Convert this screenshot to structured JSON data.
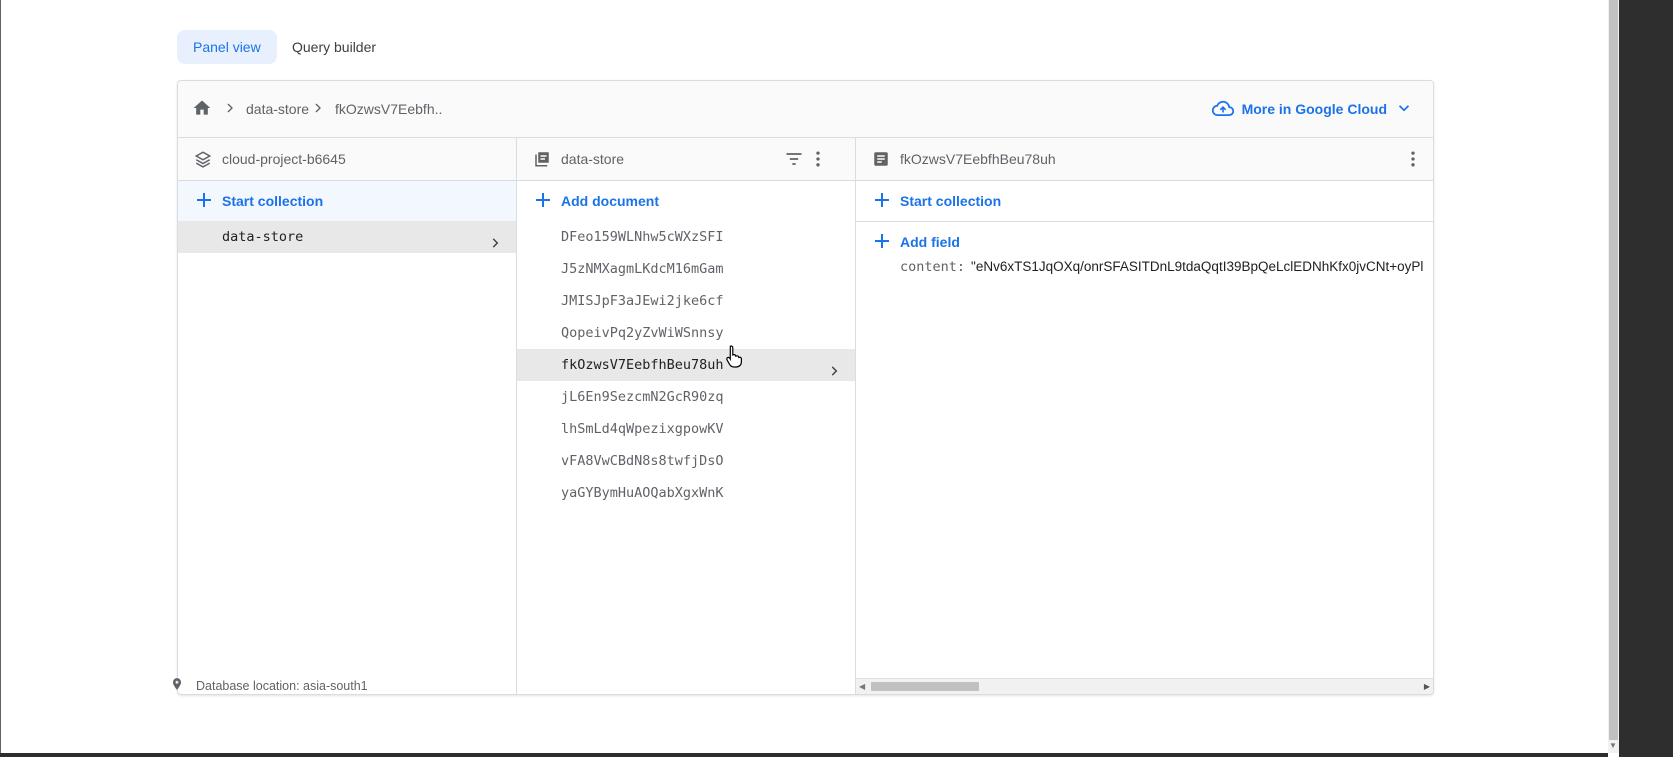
{
  "tabs": {
    "panel_view": "Panel view",
    "query_builder": "Query builder"
  },
  "breadcrumb": {
    "collection": "data-store",
    "document": "fkOzwsV7Eebfh.."
  },
  "header": {
    "cloud_label": "More in Google Cloud"
  },
  "columns": {
    "project": {
      "title": "cloud-project-b6645",
      "action": "Start collection",
      "items": [
        "data-store"
      ],
      "selected_index": 0
    },
    "collection": {
      "title": "data-store",
      "action": "Add document",
      "items": [
        "DFeo159WLNhw5cWXzSFI",
        "J5zNMXagmLKdcM16mGam",
        "JMISJpF3aJEwi2jke6cf",
        "QopeivPq2yZvWiWSnnsy",
        "fkOzwsV7EebfhBeu78uh",
        "jL6En9SezcmN2GcR90zq",
        "lhSmLd4qWpezixgpowKV",
        "vFA8VwCBdN8s8twfjDsO",
        "yaGYBymHuAOQabXgxWnK"
      ],
      "selected_index": 4
    },
    "document": {
      "title": "fkOzwsV7EebfhBeu78uh",
      "action": "Start collection",
      "add_field": "Add field",
      "field_key": "content:",
      "field_value": "\"eNv6xTS1JqOXq/onrSFASITDnL9tdaQqtI39BpQeLclEDNhKfx0jvCNt+oyPl"
    }
  },
  "footer": {
    "location": "Database location: asia-south1"
  },
  "colors": {
    "accent": "#1a73e8",
    "selected_tab_bg": "#e8f0fe",
    "selected_row": "#e8e8e8"
  }
}
